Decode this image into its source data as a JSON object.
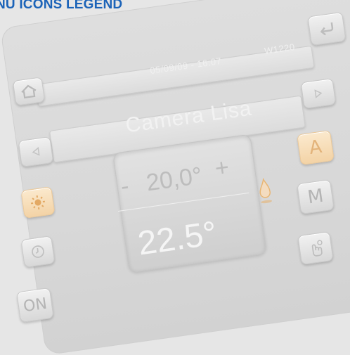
{
  "legend": {
    "title": "NU ICONS LEGEND"
  },
  "status_bar": {
    "datetime": "05/09/09 - 16:07",
    "code": "W1220"
  },
  "room": {
    "name": "Camera Lisa"
  },
  "display": {
    "setpoint_minus": "-",
    "setpoint_value": "20,0°",
    "setpoint_plus": "+",
    "temperature": "22.5°"
  },
  "buttons": {
    "auto_label": "A",
    "manual_label": "M",
    "on_label": "ON"
  },
  "icons": {
    "back": "back-arrow-icon",
    "home": "home-icon",
    "prev": "triangle-left-icon",
    "next": "triangle-right-icon",
    "sun": "sun-icon",
    "clock": "clock-icon",
    "flame": "flame-icon",
    "hand": "hand-touch-icon"
  },
  "colors": {
    "accent": "#1b63b8",
    "orange_button": "#f3d3a6",
    "flame": "#e8b675"
  }
}
